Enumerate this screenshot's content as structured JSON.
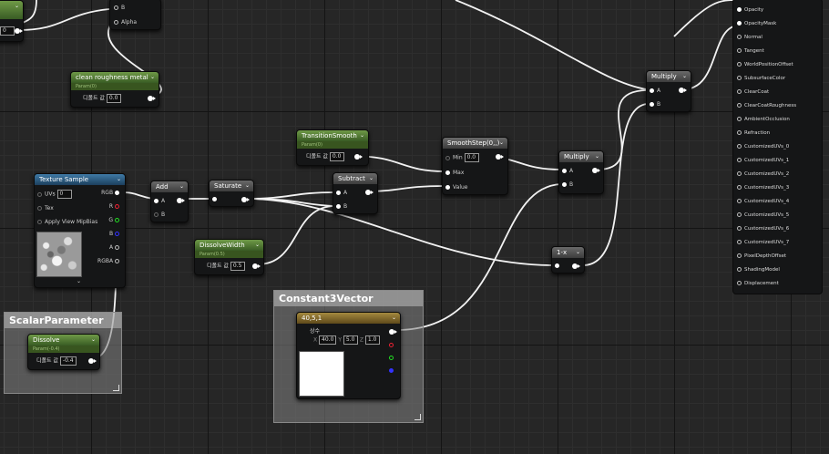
{
  "nodes": {
    "partial_top_left": {
      "pin_b": "B",
      "pin_alpha": "Alpha",
      "value": "0"
    },
    "clean_roughness": {
      "title": "clean roughness metal",
      "subtitle": "Param(0)",
      "default_label": "디폴트 값",
      "default_value": "0.0"
    },
    "transition_smooth": {
      "title": "TransitionSmooth",
      "subtitle": "Param(0)",
      "default_label": "디폴트 값",
      "default_value": "0.0"
    },
    "smoothstep": {
      "title": "SmoothStep(0,,)",
      "pin_min": "Min",
      "min_value": "0.0",
      "pin_max": "Max",
      "pin_value": "Value"
    },
    "multiply_top": {
      "title": "Multiply",
      "pin_a": "A",
      "pin_b": "B"
    },
    "multiply_mid": {
      "title": "Multiply",
      "pin_a": "A",
      "pin_b": "B"
    },
    "texture_sample": {
      "title": "Texture Sample",
      "pin_uvs": "UVs",
      "uvs_value": "0",
      "pin_tex": "Tex",
      "pin_mip": "Apply View MipBias",
      "out_rgb": "RGB",
      "out_r": "R",
      "out_g": "G",
      "out_b": "B",
      "out_a": "A",
      "out_rgba": "RGBA"
    },
    "add": {
      "title": "Add",
      "pin_a": "A",
      "pin_b": "B"
    },
    "saturate": {
      "title": "Saturate"
    },
    "subtract": {
      "title": "Subtract",
      "pin_a": "A",
      "pin_b": "B"
    },
    "dissolve_width": {
      "title": "DissolveWidth",
      "subtitle": "Param(0.5)",
      "default_label": "디폴트 값",
      "default_value": "0.5"
    },
    "one_minus": {
      "title": "1-x"
    },
    "dissolve": {
      "title": "Dissolve",
      "subtitle": "Param(-0.4)",
      "default_label": "디폴트 값",
      "default_value": "-0.4"
    },
    "constant3": {
      "title": "40,5,1",
      "const_label": "상수",
      "x_label": "X",
      "x_value": "40.0",
      "y_label": "Y",
      "y_value": "5.0",
      "z_label": "Z",
      "z_value": "1.0"
    }
  },
  "comments": {
    "scalar": "ScalarParameter",
    "constant3vector": "Constant3Vector"
  },
  "material_inputs": [
    "Opacity",
    "OpacityMask",
    "Normal",
    "Tangent",
    "WorldPositionOffset",
    "SubsurfaceColor",
    "ClearCoat",
    "ClearCoatRoughness",
    "AmbientOcclusion",
    "Refraction",
    "CustomizedUVs_0",
    "CustomizedUVs_1",
    "CustomizedUVs_2",
    "CustomizedUVs_3",
    "CustomizedUVs_4",
    "CustomizedUVs_5",
    "CustomizedUVs_6",
    "CustomizedUVs_7",
    "PixelDepthOffset",
    "ShadingModel",
    "Displacement"
  ],
  "colors": {
    "param_header": "#4f7a33",
    "texture_header": "#2e5f86",
    "vector_header": "#8a7030",
    "wire": "#f2f2f2"
  }
}
